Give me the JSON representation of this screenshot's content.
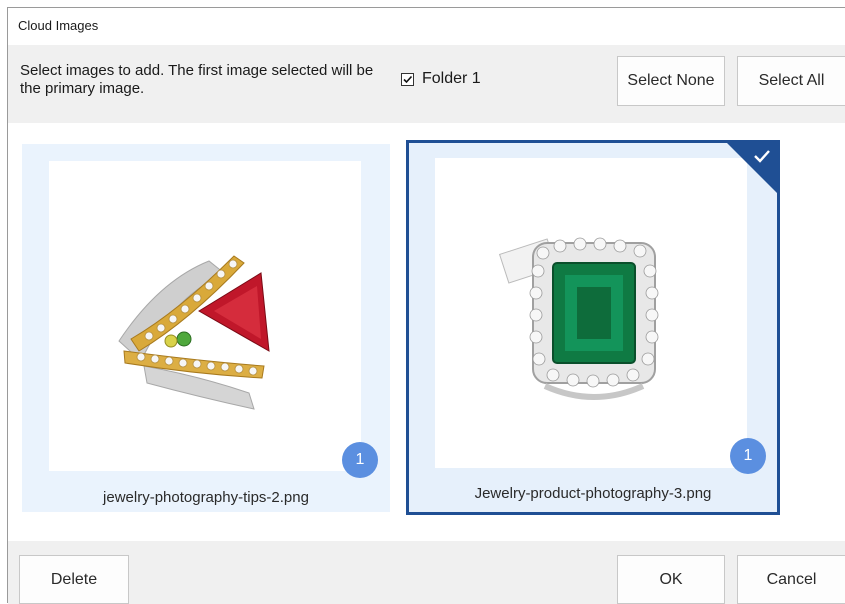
{
  "window": {
    "title": "Cloud Images"
  },
  "toolbar": {
    "instructions": "Select images to add.  The first image selected will be the primary image.",
    "folder_label": "Folder 1",
    "folder_checked": true,
    "select_none_label": "Select None",
    "select_all_label": "Select All"
  },
  "images": [
    {
      "filename": "jewelry-photography-tips-2.png",
      "badge": "1",
      "selected": false,
      "icon": "ruby-ring-photo"
    },
    {
      "filename": "Jewelry-product-photography-3.png",
      "badge": "1",
      "selected": true,
      "icon": "emerald-ring-photo"
    }
  ],
  "footer": {
    "delete_label": "Delete",
    "ok_label": "OK",
    "cancel_label": "Cancel"
  },
  "colors": {
    "selection_border": "#1f4f94",
    "badge": "#5b8fe0",
    "card_bg": "#eaf3fd",
    "toolbar_bg": "#f0f0f0"
  }
}
